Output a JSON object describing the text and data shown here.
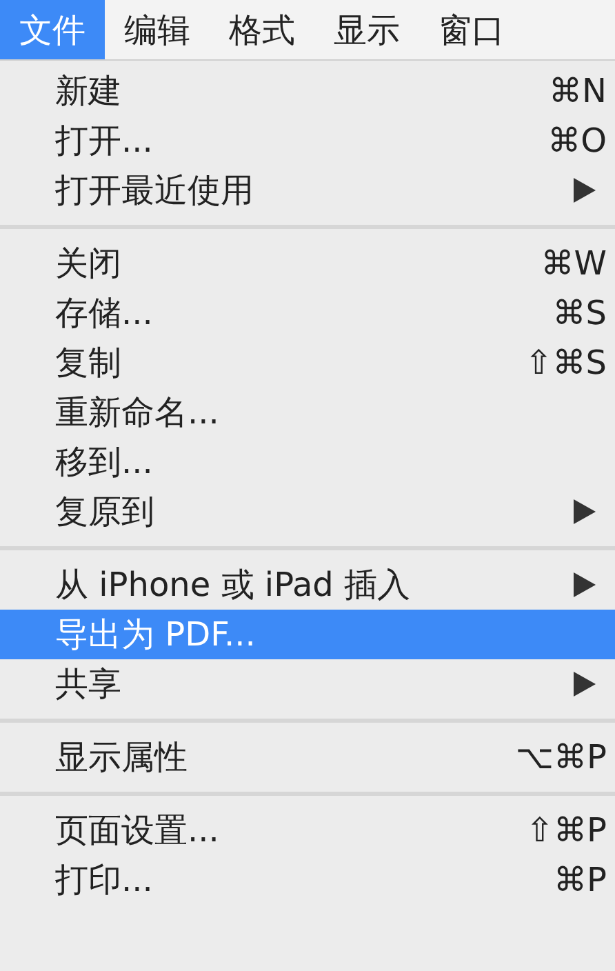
{
  "menu_bar": [
    {
      "label": "文件",
      "selected": true
    },
    {
      "label": "编辑",
      "selected": false
    },
    {
      "label": "格式",
      "selected": false
    },
    {
      "label": "显示",
      "selected": false
    },
    {
      "label": "窗口",
      "selected": false
    }
  ],
  "menu": {
    "groups": [
      [
        {
          "label": "新建",
          "shortcut": "⌘N",
          "submenu": false,
          "selected": false
        },
        {
          "label": "打开...",
          "shortcut": "⌘O",
          "submenu": false,
          "selected": false
        },
        {
          "label": "打开最近使用",
          "submenu": true,
          "selected": false
        }
      ],
      [
        {
          "label": "关闭",
          "shortcut": "⌘W",
          "submenu": false,
          "selected": false
        },
        {
          "label": "存储...",
          "shortcut": "⌘S",
          "submenu": false,
          "selected": false
        },
        {
          "label": "复制",
          "shortcut": "⇧⌘S",
          "submenu": false,
          "selected": false
        },
        {
          "label": "重新命名...",
          "submenu": false,
          "selected": false
        },
        {
          "label": "移到...",
          "submenu": false,
          "selected": false
        },
        {
          "label": "复原到",
          "submenu": true,
          "selected": false
        }
      ],
      [
        {
          "label": "从 iPhone 或 iPad 插入",
          "submenu": true,
          "selected": false
        },
        {
          "label": "导出为 PDF...",
          "submenu": false,
          "selected": true
        },
        {
          "label": "共享",
          "submenu": true,
          "selected": false
        }
      ],
      [
        {
          "label": "显示属性",
          "shortcut": "⌥⌘P",
          "submenu": false,
          "selected": false
        }
      ],
      [
        {
          "label": "页面设置...",
          "shortcut": "⇧⌘P",
          "submenu": false,
          "selected": false
        },
        {
          "label": "打印...",
          "shortcut": "⌘P",
          "submenu": false,
          "selected": false
        }
      ]
    ]
  }
}
